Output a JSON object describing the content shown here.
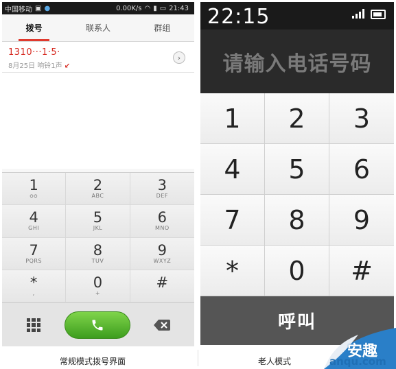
{
  "left_phone": {
    "status_bar": {
      "carrier": "中国移动",
      "speed": "0.00K/s",
      "time": "21:43"
    },
    "tabs": [
      {
        "label": "拨号",
        "active": true
      },
      {
        "label": "联系人",
        "active": false
      },
      {
        "label": "群组",
        "active": false
      }
    ],
    "call_log": [
      {
        "number": "1310···1·5·",
        "info": "8月25日  响铃1声",
        "type": "missed"
      }
    ],
    "keys": [
      {
        "digit": "1",
        "sub": "ᴑᴑ"
      },
      {
        "digit": "2",
        "sub": "ABC"
      },
      {
        "digit": "3",
        "sub": "DEF"
      },
      {
        "digit": "4",
        "sub": "GHI"
      },
      {
        "digit": "5",
        "sub": "JKL"
      },
      {
        "digit": "6",
        "sub": "MNO"
      },
      {
        "digit": "7",
        "sub": "PQRS"
      },
      {
        "digit": "8",
        "sub": "TUV"
      },
      {
        "digit": "9",
        "sub": "WXYZ"
      },
      {
        "digit": "*",
        "sub": ","
      },
      {
        "digit": "0",
        "sub": "+"
      },
      {
        "digit": "#",
        "sub": ""
      }
    ],
    "colors": {
      "accent": "#e03a2f",
      "call_green": "#4cb426"
    }
  },
  "right_phone": {
    "time": "22:15",
    "placeholder": "请输入电话号码",
    "keys": [
      "1",
      "2",
      "3",
      "4",
      "5",
      "6",
      "7",
      "8",
      "9",
      "*",
      "0",
      "#"
    ],
    "call_label": "呼叫"
  },
  "captions": {
    "left": "常规模式拨号界面",
    "right": "老人模式"
  },
  "watermark": {
    "brand": "安趣",
    "site": "anqu.com"
  }
}
